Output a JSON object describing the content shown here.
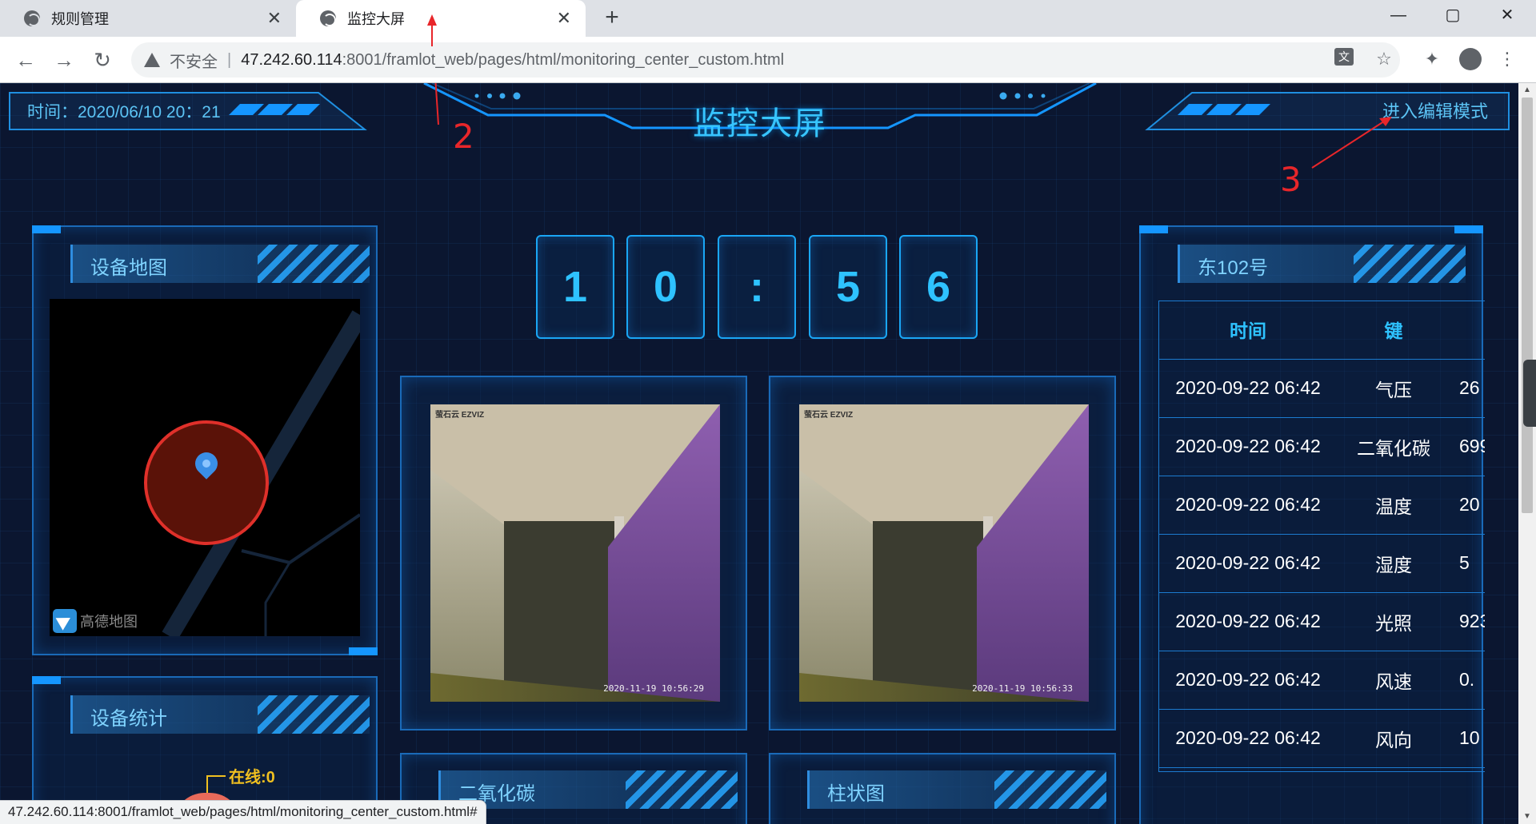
{
  "browser": {
    "tabs": [
      {
        "label": "规则管理",
        "active": false
      },
      {
        "label": "监控大屏",
        "active": true
      }
    ],
    "new_tab": "+",
    "window_controls": {
      "minimize": "—",
      "maximize": "▢",
      "close": "✕"
    },
    "address": {
      "security_label": "不安全",
      "separator": "|",
      "host": "47.242.60.114",
      "path": ":8001/framlot_web/pages/html/monitoring_center_custom.html"
    },
    "status_url": "47.242.60.114:8001/framlot_web/pages/html/monitoring_center_custom.html#"
  },
  "dashboard": {
    "time_label": "时间：2020/06/10 20：21",
    "title": "监控大屏",
    "edit_mode": "进入编辑模式",
    "clock_digits": [
      "1",
      "0",
      ":",
      "5",
      "6"
    ],
    "map_panel": {
      "title": "设备地图",
      "map_logo_text": "高德地图"
    },
    "stats_panel": {
      "title": "设备统计",
      "online_label": "在线:0"
    },
    "co2_panel": {
      "title": "二氧化碳"
    },
    "bar_panel": {
      "title": "柱状图"
    },
    "cameras": [
      {
        "logo": "萤石云 EZVIZ",
        "timestamp": "2020-11-19 10:56:29"
      },
      {
        "logo": "萤石云 EZVIZ",
        "timestamp": "2020-11-19 10:56:33"
      }
    ],
    "device_panel": {
      "title": "东102号",
      "columns": [
        "时间",
        "键",
        ""
      ],
      "rows": [
        [
          "2020-09-22 06:42",
          "气压",
          "26"
        ],
        [
          "2020-09-22 06:42",
          "二氧化碳",
          "699"
        ],
        [
          "2020-09-22 06:42",
          "温度",
          "20"
        ],
        [
          "2020-09-22 06:42",
          "湿度",
          "5"
        ],
        [
          "2020-09-22 06:42",
          "光照",
          "923"
        ],
        [
          "2020-09-22 06:42",
          "风速",
          "0."
        ],
        [
          "2020-09-22 06:42",
          "风向",
          "10"
        ]
      ]
    }
  },
  "annotations": [
    "2",
    "3"
  ],
  "colors": {
    "accent": "#2ec2ff",
    "panel_border": "#1a6ab8",
    "annotation": "#e8262a",
    "background": "#0b1630"
  }
}
